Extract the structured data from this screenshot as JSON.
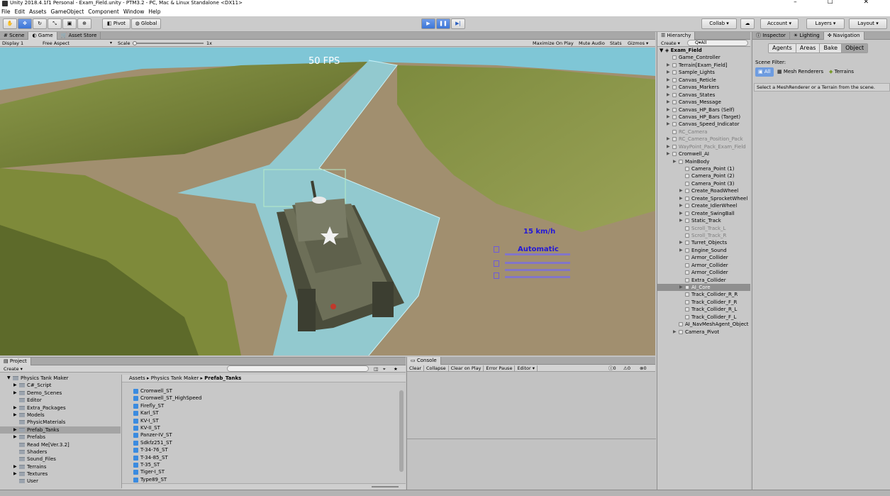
{
  "window": {
    "title": "Unity 2018.4.1f1 Personal - Exam_Field.unity - PTM3.2 - PC, Mac & Linux Standalone <DX11>",
    "controls": "–  ☐  ✕"
  },
  "menu": [
    "File",
    "Edit",
    "Assets",
    "GameObject",
    "Component",
    "Window",
    "Help"
  ],
  "toolbar": {
    "pivot": "Pivot",
    "global": "Global",
    "collab": "Collab ▾",
    "account": "Account ▾",
    "layers": "Layers ▾",
    "layout": "Layout ▾"
  },
  "scene_tabs": {
    "scene": "Scene",
    "game": "Game",
    "asset_store": "Asset Store"
  },
  "game_bar": {
    "display": "Display 1",
    "aspect": "Free Aspect",
    "scale_label": "Scale",
    "scale_value": "1x",
    "maximize": "Maximize On Play",
    "mute": "Mute Audio",
    "stats": "Stats",
    "gizmos": "Gizmos ▾"
  },
  "hud": {
    "fps": "50 FPS",
    "speed": "15 km/h",
    "mode": "Automatic"
  },
  "hierarchy": {
    "tab": "Hierarchy",
    "create": "Create ▾",
    "search_placeholder": "Q▾All",
    "scene": "Exam_Field",
    "items": [
      {
        "label": "Game_Controller",
        "indent": 1,
        "arrow": false,
        "dim": false,
        "sel": false
      },
      {
        "label": "Terrain[Exam_Field]",
        "indent": 1,
        "arrow": true,
        "dim": false,
        "sel": false
      },
      {
        "label": "Sample_Lights",
        "indent": 1,
        "arrow": true,
        "dim": false,
        "sel": false
      },
      {
        "label": "Canvas_Reticle",
        "indent": 1,
        "arrow": true,
        "dim": false,
        "sel": false
      },
      {
        "label": "Canvas_Markers",
        "indent": 1,
        "arrow": true,
        "dim": false,
        "sel": false
      },
      {
        "label": "Canvas_States",
        "indent": 1,
        "arrow": true,
        "dim": false,
        "sel": false
      },
      {
        "label": "Canvas_Message",
        "indent": 1,
        "arrow": true,
        "dim": false,
        "sel": false
      },
      {
        "label": "Canvas_HP_Bars (Self)",
        "indent": 1,
        "arrow": true,
        "dim": false,
        "sel": false
      },
      {
        "label": "Canvas_HP_Bars (Target)",
        "indent": 1,
        "arrow": true,
        "dim": false,
        "sel": false
      },
      {
        "label": "Canvas_Speed_Indicator",
        "indent": 1,
        "arrow": true,
        "dim": false,
        "sel": false
      },
      {
        "label": "RC_Camera",
        "indent": 1,
        "arrow": false,
        "dim": true,
        "sel": false
      },
      {
        "label": "RC_Camera_Position_Pack",
        "indent": 1,
        "arrow": true,
        "dim": true,
        "sel": false
      },
      {
        "label": "WayPoint_Pack_Exam_Field",
        "indent": 1,
        "arrow": true,
        "dim": true,
        "sel": false
      },
      {
        "label": "Cromwell_AI",
        "indent": 1,
        "arrow": true,
        "dim": false,
        "sel": false
      },
      {
        "label": "MainBody",
        "indent": 2,
        "arrow": true,
        "dim": false,
        "sel": false
      },
      {
        "label": "Camera_Point (1)",
        "indent": 3,
        "arrow": false,
        "dim": false,
        "sel": false
      },
      {
        "label": "Camera_Point (2)",
        "indent": 3,
        "arrow": false,
        "dim": false,
        "sel": false
      },
      {
        "label": "Camera_Point (3)",
        "indent": 3,
        "arrow": false,
        "dim": false,
        "sel": false
      },
      {
        "label": "Create_RoadWheel",
        "indent": 3,
        "arrow": true,
        "dim": false,
        "sel": false
      },
      {
        "label": "Create_SprocketWheel",
        "indent": 3,
        "arrow": true,
        "dim": false,
        "sel": false
      },
      {
        "label": "Create_IdlerWheel",
        "indent": 3,
        "arrow": true,
        "dim": false,
        "sel": false
      },
      {
        "label": "Create_SwingBall",
        "indent": 3,
        "arrow": true,
        "dim": false,
        "sel": false
      },
      {
        "label": "Static_Track",
        "indent": 3,
        "arrow": true,
        "dim": false,
        "sel": false
      },
      {
        "label": "Scroll_Track_L",
        "indent": 3,
        "arrow": false,
        "dim": true,
        "sel": false
      },
      {
        "label": "Scroll_Track_R",
        "indent": 3,
        "arrow": false,
        "dim": true,
        "sel": false
      },
      {
        "label": "Turret_Objects",
        "indent": 3,
        "arrow": true,
        "dim": false,
        "sel": false
      },
      {
        "label": "Engine_Sound",
        "indent": 3,
        "arrow": true,
        "dim": false,
        "sel": false
      },
      {
        "label": "Armor_Collider",
        "indent": 3,
        "arrow": false,
        "dim": false,
        "sel": false
      },
      {
        "label": "Armor_Collider",
        "indent": 3,
        "arrow": false,
        "dim": false,
        "sel": false
      },
      {
        "label": "Armor_Collider",
        "indent": 3,
        "arrow": false,
        "dim": false,
        "sel": false
      },
      {
        "label": "Extra_Collider",
        "indent": 3,
        "arrow": false,
        "dim": false,
        "sel": false
      },
      {
        "label": "AI_Core",
        "indent": 3,
        "arrow": true,
        "dim": false,
        "sel": true
      },
      {
        "label": "Track_Collider_R_R",
        "indent": 3,
        "arrow": false,
        "dim": false,
        "sel": false
      },
      {
        "label": "Track_Collider_F_R",
        "indent": 3,
        "arrow": false,
        "dim": false,
        "sel": false
      },
      {
        "label": "Track_Collider_R_L",
        "indent": 3,
        "arrow": false,
        "dim": false,
        "sel": false
      },
      {
        "label": "Track_Collider_F_L",
        "indent": 3,
        "arrow": false,
        "dim": false,
        "sel": false
      },
      {
        "label": "AI_NavMeshAgent_Object",
        "indent": 2,
        "arrow": false,
        "dim": false,
        "sel": false
      },
      {
        "label": "Camera_Pivot",
        "indent": 2,
        "arrow": true,
        "dim": false,
        "sel": false
      }
    ]
  },
  "inspector": {
    "tabs": [
      "Inspector",
      "Lighting",
      "Navigation"
    ],
    "nav_tabs": [
      "Agents",
      "Areas",
      "Bake",
      "Object"
    ],
    "scene_filter": "Scene Filter:",
    "filters": [
      "All",
      "Mesh Renderers",
      "Terrains"
    ],
    "hint": "Select a MeshRenderer or a Terrain from the scene."
  },
  "project": {
    "tab": "Project",
    "create": "Create ▾",
    "tree": [
      {
        "label": "Physics Tank Maker",
        "indent": 0,
        "arrow": "▼",
        "sel": false
      },
      {
        "label": "C#_Script",
        "indent": 1,
        "arrow": "▶",
        "sel": false
      },
      {
        "label": "Demo_Scenes",
        "indent": 1,
        "arrow": "▶",
        "sel": false
      },
      {
        "label": "Editor",
        "indent": 1,
        "arrow": "",
        "sel": false
      },
      {
        "label": "Extra_Packages",
        "indent": 1,
        "arrow": "▶",
        "sel": false
      },
      {
        "label": "Models",
        "indent": 1,
        "arrow": "▶",
        "sel": false
      },
      {
        "label": "PhysicMaterials",
        "indent": 1,
        "arrow": "",
        "sel": false
      },
      {
        "label": "Prefab_Tanks",
        "indent": 1,
        "arrow": "▶",
        "sel": true
      },
      {
        "label": "Prefabs",
        "indent": 1,
        "arrow": "▶",
        "sel": false
      },
      {
        "label": "Read Me[Ver.3.2]",
        "indent": 1,
        "arrow": "",
        "sel": false
      },
      {
        "label": "Shaders",
        "indent": 1,
        "arrow": "",
        "sel": false
      },
      {
        "label": "Sound_Files",
        "indent": 1,
        "arrow": "",
        "sel": false
      },
      {
        "label": "Terrains",
        "indent": 1,
        "arrow": "▶",
        "sel": false
      },
      {
        "label": "Textures",
        "indent": 1,
        "arrow": "▶",
        "sel": false
      },
      {
        "label": "User",
        "indent": 1,
        "arrow": "",
        "sel": false
      }
    ],
    "breadcrumb": [
      "Assets",
      "Physics Tank Maker",
      "Prefab_Tanks"
    ],
    "assets": [
      "Cromwell_ST",
      "Cromwell_ST_HighSpeed",
      "Firefly_ST",
      "Karl_ST",
      "KV-I_ST",
      "KV-II_ST",
      "Panzer-IV_ST",
      "Sdkfz251_ST",
      "T-34-76_ST",
      "T-34-85_ST",
      "T-35_ST",
      "Tiger-I_ST",
      "Type89_ST"
    ]
  },
  "console": {
    "tab": "Console",
    "buttons": [
      "Clear",
      "Collapse",
      "Clear on Play",
      "Error Pause",
      "Editor ▾"
    ],
    "counts": [
      "0",
      "0",
      "0"
    ]
  }
}
